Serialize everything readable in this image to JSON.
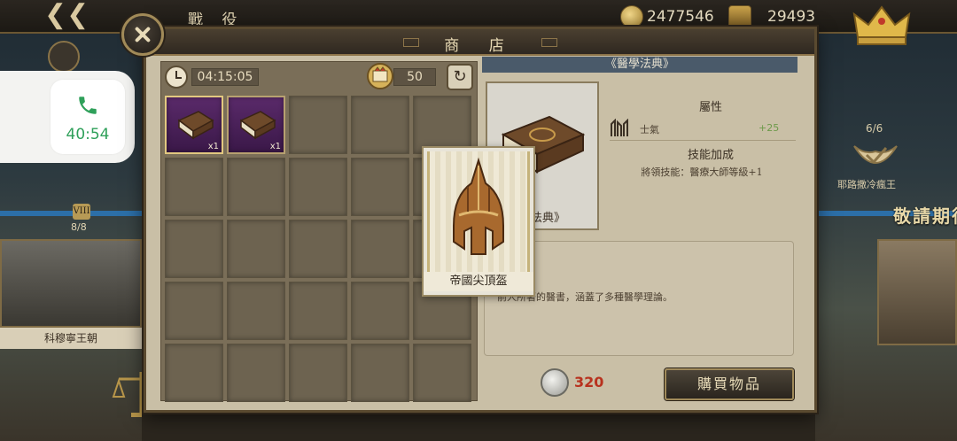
{
  "header": {
    "back_icon": "back-arrow-icon",
    "title": "戰 役",
    "gold": "2477546",
    "chest_value": "29493"
  },
  "call": {
    "time": "40:54",
    "icon": "phone-icon",
    "accent": "#2fa05a"
  },
  "background": {
    "left_badge": "VIII",
    "left_count": "8/8",
    "left_card_label": "科穆寧王朝",
    "right_count": "6/6",
    "right_caption": "耶路撒冷瘋王",
    "right_title": "敬請期待"
  },
  "shop": {
    "title": "商 店",
    "timer": "04:15:05",
    "currency_amount": "50",
    "refresh_icon": "refresh-icon",
    "slots": [
      {
        "filled": true,
        "selected": true,
        "qty": "x1"
      },
      {
        "filled": true,
        "selected": false,
        "qty": "x1"
      },
      {
        "filled": false
      },
      {
        "filled": false
      },
      {
        "filled": false
      },
      {
        "filled": false
      },
      {
        "filled": false
      },
      {
        "filled": false
      },
      {
        "filled": false
      },
      {
        "filled": false
      },
      {
        "filled": false
      },
      {
        "filled": false
      },
      {
        "filled": false
      },
      {
        "filled": false
      },
      {
        "filled": false
      },
      {
        "filled": false
      },
      {
        "filled": false
      },
      {
        "filled": false
      },
      {
        "filled": false
      },
      {
        "filled": false
      },
      {
        "filled": false
      },
      {
        "filled": false
      },
      {
        "filled": false
      },
      {
        "filled": false
      },
      {
        "filled": false
      }
    ]
  },
  "item": {
    "header": "《醫學法典》",
    "card_label": "學法典》",
    "attr_title": "屬性",
    "attr_name": "士氣",
    "attr_value": "+25",
    "skill_title": "技能加成",
    "skill_desc": "將領技能：醫療大師等級+1",
    "description": "前人所著的醫書，涵蓋了多種醫學理論。",
    "price": "320",
    "buy_label": "購買物品"
  },
  "tooltip": {
    "label": "帝國尖頂盔",
    "icon": "helmet-icon"
  }
}
